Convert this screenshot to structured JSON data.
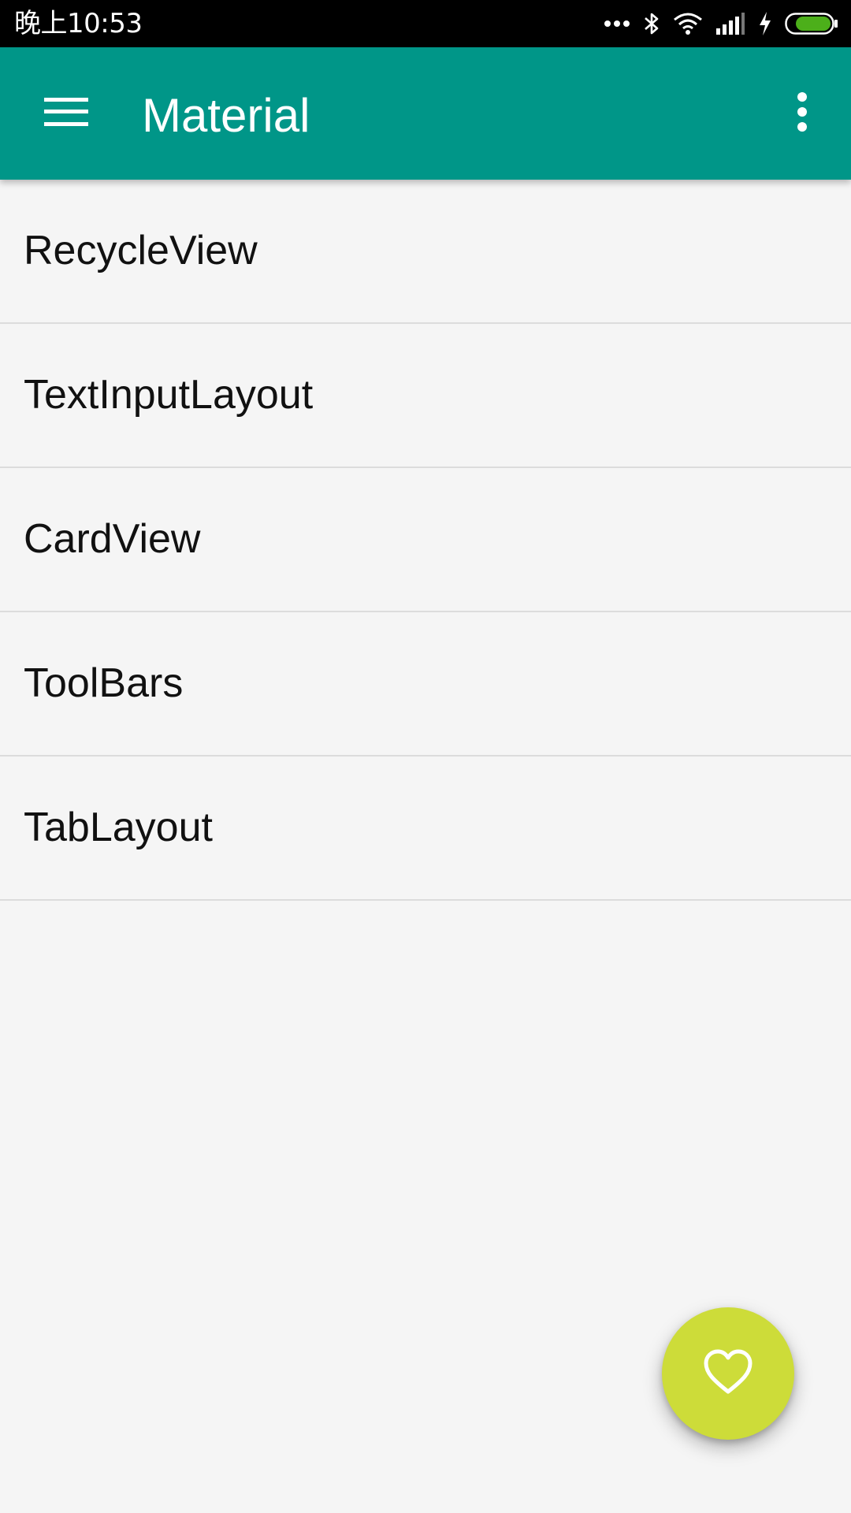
{
  "status_bar": {
    "time": "晚上10:53",
    "icons": [
      "more-notifications-icon",
      "bluetooth-icon",
      "wifi-icon",
      "signal-icon",
      "charging-icon",
      "battery-icon"
    ],
    "battery_color": "#4caf1a"
  },
  "app_bar": {
    "title": "Material",
    "color": "#009688",
    "menu_icon": "hamburger-menu-icon",
    "overflow_icon": "more-vert-icon"
  },
  "list": {
    "items": [
      {
        "label": "RecycleView"
      },
      {
        "label": "TextInputLayout"
      },
      {
        "label": "CardView"
      },
      {
        "label": "ToolBars"
      },
      {
        "label": "TabLayout"
      }
    ]
  },
  "fab": {
    "icon": "heart-icon",
    "color": "#cddc39"
  }
}
